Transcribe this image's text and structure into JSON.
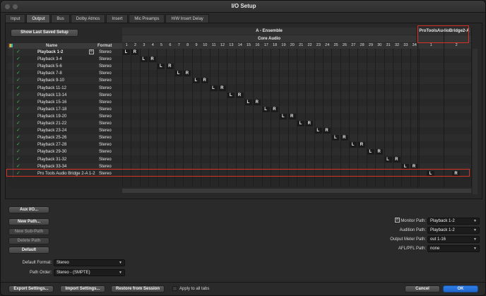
{
  "window": {
    "title": "I/O Setup"
  },
  "tabs": [
    {
      "label": "Input",
      "active": false
    },
    {
      "label": "Output",
      "active": true
    },
    {
      "label": "Bus",
      "active": false
    },
    {
      "label": "Dolby Atmos",
      "active": false
    },
    {
      "label": "Insert",
      "active": false
    },
    {
      "label": "Mic Preamps",
      "active": false
    },
    {
      "label": "H/W Insert Delay",
      "active": false
    }
  ],
  "top_button": {
    "label": "Show Last Saved Setup"
  },
  "matrix": {
    "group1": {
      "title": "A - Ensemble",
      "subtitle": "Core Audio"
    },
    "group2": {
      "title": "ProToolsAudioBridge2-A"
    },
    "col_name": "Name",
    "col_format": "Format",
    "core_columns": [
      "1",
      "2",
      "3",
      "4",
      "5",
      "6",
      "7",
      "8",
      "9",
      "10",
      "11",
      "12",
      "13",
      "14",
      "15",
      "16",
      "17",
      "18",
      "19",
      "20",
      "21",
      "22",
      "23",
      "24",
      "25",
      "26",
      "27",
      "28",
      "29",
      "30",
      "31",
      "32",
      "33",
      "34"
    ],
    "bridge_columns": [
      "1",
      "2"
    ],
    "rows": [
      {
        "name": "Playback 1-2",
        "format": "Stereo",
        "bold": true,
        "tag": "b"
      },
      {
        "name": "Playback 3-4",
        "format": "Stereo"
      },
      {
        "name": "Playback 5-6",
        "format": "Stereo"
      },
      {
        "name": "Playback 7-8",
        "format": "Stereo"
      },
      {
        "name": "Playback 9-10",
        "format": "Stereo"
      },
      {
        "name": "Playback 11-12",
        "format": "Stereo"
      },
      {
        "name": "Playback 13-14",
        "format": "Stereo"
      },
      {
        "name": "Playback 15-16",
        "format": "Stereo"
      },
      {
        "name": "Playback 17-18",
        "format": "Stereo"
      },
      {
        "name": "Playback 19-20",
        "format": "Stereo"
      },
      {
        "name": "Playback 21-22",
        "format": "Stereo"
      },
      {
        "name": "Playback 23-24",
        "format": "Stereo"
      },
      {
        "name": "Playback 25-26",
        "format": "Stereo"
      },
      {
        "name": "Playback 27-28",
        "format": "Stereo"
      },
      {
        "name": "Playback 29-30",
        "format": "Stereo"
      },
      {
        "name": "Playback 31-32",
        "format": "Stereo"
      },
      {
        "name": "Playback 33-34",
        "format": "Stereo"
      },
      {
        "name": "Pro Tools Audio Bridge 2-A 1-2",
        "format": "Stereo",
        "bridge": true
      }
    ],
    "cell_left": "L",
    "cell_right": "R"
  },
  "left_buttons": {
    "aux": "Aux I/O...",
    "new_path": "New Path...",
    "new_sub_path": "New Sub-Path",
    "delete_path": "Delete Path",
    "default": "Default"
  },
  "bottom_fields": {
    "default_format_label": "Default Format:",
    "default_format_value": "Stereo",
    "path_order_label": "Path Order:",
    "path_order_value": "Stereo - (SMPTE)"
  },
  "right_fields": [
    {
      "label": "Monitor Path:",
      "value": "Playback 1-2",
      "badge": "b"
    },
    {
      "label": "Audition Path:",
      "value": "Playback 1-2"
    },
    {
      "label": "Output Meter Path:",
      "value": "out 1-16"
    },
    {
      "label": "AFL/PFL Path:",
      "value": "none"
    }
  ],
  "footer": {
    "export": "Export Settings...",
    "import": "Import Settings...",
    "restore": "Restore from Session",
    "apply_all": "Apply to all tabs",
    "cancel": "Cancel",
    "ok": "OK"
  },
  "colors": {
    "accent": "#2f7de8",
    "highlight": "#d93025",
    "check": "#36c24a"
  }
}
